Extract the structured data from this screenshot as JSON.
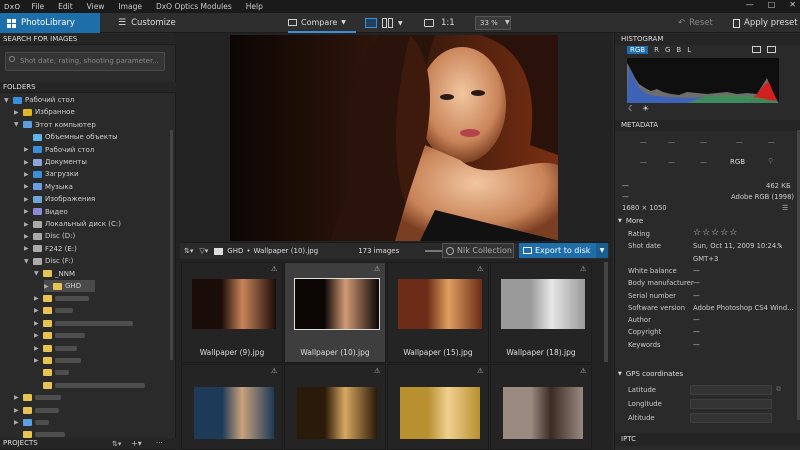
{
  "app": {
    "logo": "DxO"
  },
  "menu": [
    "File",
    "Edit",
    "View",
    "Image",
    "DxO Optics Modules",
    "Help"
  ],
  "window_controls": [
    "—",
    "□",
    "✕"
  ],
  "toolbar": {
    "tab_photolibrary": "PhotoLibrary",
    "tab_customize": "Customize",
    "compare_label": "Compare",
    "one_to_one": "1:1",
    "zoom": "33 %",
    "reset_label": "Reset",
    "apply_label": "Apply preset"
  },
  "left": {
    "search_header": "SEARCH FOR IMAGES",
    "search_placeholder": "Shot date, rating, shooting parameter...",
    "folders_header": "FOLDERS",
    "projects_header": "PROJECTS",
    "tree": [
      {
        "label": "Рабочий стол",
        "depth": 0,
        "tri": "▼",
        "icon": "desktop-icon"
      },
      {
        "label": "Избранное",
        "depth": 1,
        "tri": "▶",
        "icon": "star-icon"
      },
      {
        "label": "Этот компьютер",
        "depth": 1,
        "tri": "▼",
        "icon": "computer-icon"
      },
      {
        "label": "Объемные объекты",
        "depth": 2,
        "tri": "",
        "icon": "cube-icon"
      },
      {
        "label": "Рабочий стол",
        "depth": 2,
        "tri": "▶",
        "icon": "desktop-icon"
      },
      {
        "label": "Документы",
        "depth": 2,
        "tri": "▶",
        "icon": "document-icon"
      },
      {
        "label": "Загрузки",
        "depth": 2,
        "tri": "▶",
        "icon": "download-icon"
      },
      {
        "label": "Музыка",
        "depth": 2,
        "tri": "▶",
        "icon": "music-icon"
      },
      {
        "label": "Изображения",
        "depth": 2,
        "tri": "▶",
        "icon": "image-icon"
      },
      {
        "label": "Видео",
        "depth": 2,
        "tri": "▶",
        "icon": "video-icon"
      },
      {
        "label": "Локальный диск (C:)",
        "depth": 2,
        "tri": "▶",
        "icon": "drive-icon"
      },
      {
        "label": "Disc (D:)",
        "depth": 2,
        "tri": "▶",
        "icon": "drive-icon"
      },
      {
        "label": "F242 (E:)",
        "depth": 2,
        "tri": "▶",
        "icon": "drive-icon"
      },
      {
        "label": "Disc (F:)",
        "depth": 2,
        "tri": "▼",
        "icon": "drive-icon"
      },
      {
        "label": "_NNM",
        "depth": 3,
        "tri": "▼",
        "icon": "folder-icon"
      },
      {
        "label": "GHD",
        "depth": 4,
        "tri": "▶",
        "icon": "folder-icon",
        "selected": true
      },
      {
        "label": "",
        "depth": 3,
        "tri": "▶",
        "icon": "folder-icon",
        "blur": 34
      },
      {
        "label": "",
        "depth": 3,
        "tri": "▶",
        "icon": "folder-icon",
        "blur": 18
      },
      {
        "label": "",
        "depth": 3,
        "tri": "▶",
        "icon": "folder-icon",
        "blur": 78
      },
      {
        "label": "",
        "depth": 3,
        "tri": "▶",
        "icon": "folder-icon",
        "blur": 30
      },
      {
        "label": "",
        "depth": 3,
        "tri": "▶",
        "icon": "folder-icon",
        "blur": 22
      },
      {
        "label": "",
        "depth": 3,
        "tri": "▶",
        "icon": "folder-icon",
        "blur": 26
      },
      {
        "label": "",
        "depth": 3,
        "tri": "",
        "icon": "folder-icon",
        "blur": 14
      },
      {
        "label": "",
        "depth": 3,
        "tri": "",
        "icon": "folder-icon",
        "blur": 90
      },
      {
        "label": "",
        "depth": 1,
        "tri": "▶",
        "icon": "folder-icon",
        "blur": 26
      },
      {
        "label": "",
        "depth": 1,
        "tri": "▶",
        "icon": "folder-icon",
        "blur": 24
      },
      {
        "label": "",
        "depth": 1,
        "tri": "▶",
        "icon": "network-icon",
        "blur": 14
      },
      {
        "label": "",
        "depth": 1,
        "tri": "",
        "icon": "folder-icon",
        "blur": 30
      }
    ]
  },
  "filmstrip": {
    "path_folder": "GHD",
    "path_sep": "•",
    "path_file": "Wallpaper (10).jpg",
    "count": "173 images",
    "nik_label": "Nik Collection",
    "export_label": "Export to disk",
    "thumbs_row1": [
      "Wallpaper (9).jpg",
      "Wallpaper (10).jpg",
      "Wallpaper (15).jpg",
      "Wallpaper (18).jpg"
    ],
    "selected_index": 1
  },
  "right": {
    "histogram_header": "HISTOGRAM",
    "channels": [
      "RGB",
      "R",
      "G",
      "B",
      "L"
    ],
    "metadata_header": "METADATA",
    "dash": "—",
    "color_mode": "RGB",
    "file_size": "462 КБ",
    "color_profile": "Adobe RGB (1998)",
    "dimensions": "1680 × 1050",
    "more_header": "More",
    "fields": [
      {
        "label": "Rating",
        "value": "☆☆☆☆☆"
      },
      {
        "label": "Shot date",
        "value": "Sun, Oct 11, 2009 10:24..."
      },
      {
        "label": "",
        "value": "GMT+3"
      },
      {
        "label": "White balance",
        "value": "—"
      },
      {
        "label": "Body manufacturer",
        "value": "—"
      },
      {
        "label": "Serial number",
        "value": "—"
      },
      {
        "label": "Software version",
        "value": "Adobe Photoshop CS4 Wind..."
      },
      {
        "label": "Author",
        "value": "—"
      },
      {
        "label": "Copyright",
        "value": "—"
      },
      {
        "label": "Keywords",
        "value": "—"
      }
    ],
    "gps_header": "GPS coordinates",
    "gps_fields": [
      "Latitude",
      "Longitude",
      "Altitude"
    ],
    "iptc_header": "IPTC"
  }
}
